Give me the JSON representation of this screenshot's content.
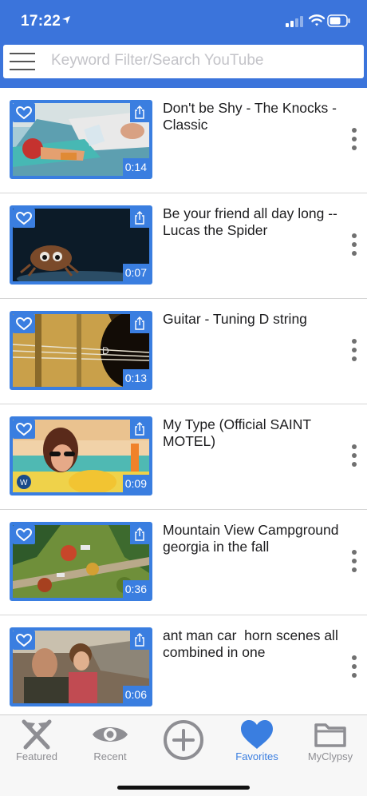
{
  "status": {
    "time": "17:22"
  },
  "search": {
    "placeholder": "Keyword Filter/Search YouTube"
  },
  "videos": [
    {
      "title": "Don't be Shy - The Knocks - Classic",
      "duration": "0:14"
    },
    {
      "title": "Be your friend all day long -- Lucas the Spider",
      "duration": "0:07"
    },
    {
      "title": "Guitar - Tuning D string",
      "duration": "0:13"
    },
    {
      "title": "My Type (Official SAINT MOTEL)",
      "duration": "0:09"
    },
    {
      "title": "Mountain View Campground georgia in the fall",
      "duration": "0:36"
    },
    {
      "title": "ant man car  horn scenes all combined in one",
      "duration": "0:06"
    }
  ],
  "tabs": [
    {
      "label": "Featured",
      "icon": "scissors-icon"
    },
    {
      "label": "Recent",
      "icon": "eye-icon"
    },
    {
      "label": "",
      "icon": "add-circle-icon"
    },
    {
      "label": "Favorites",
      "icon": "heart-icon",
      "active": true
    },
    {
      "label": "MyClypsy",
      "icon": "folder-icon"
    }
  ],
  "colors": {
    "accent": "#3a7ee0",
    "header": "#3b74db"
  }
}
